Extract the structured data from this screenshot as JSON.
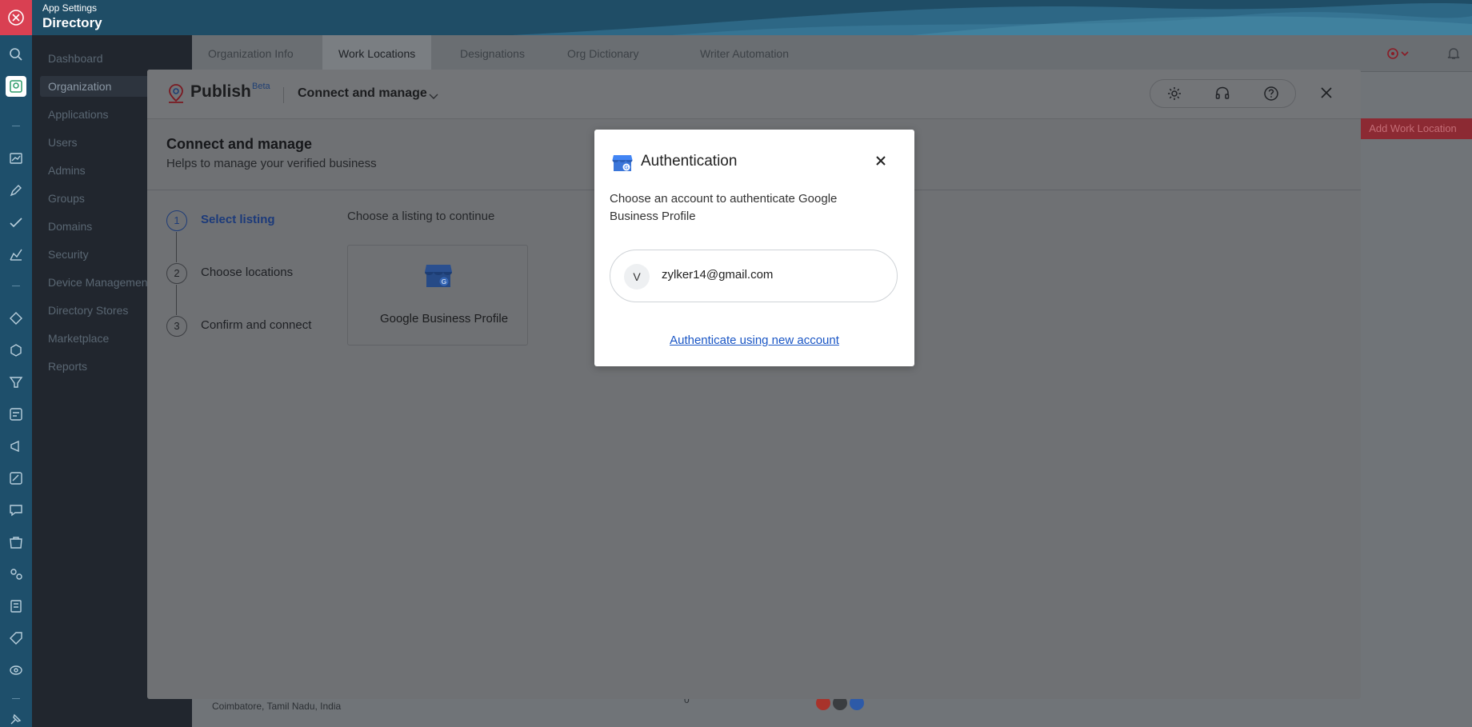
{
  "header": {
    "subtitle": "App Settings",
    "title": "Directory"
  },
  "nav": {
    "items": [
      {
        "label": "Dashboard"
      },
      {
        "label": "Organization",
        "active": true
      },
      {
        "label": "Applications"
      },
      {
        "label": "Users"
      },
      {
        "label": "Admins"
      },
      {
        "label": "Groups"
      },
      {
        "label": "Domains"
      },
      {
        "label": "Security"
      },
      {
        "label": "Device Management"
      },
      {
        "label": "Directory Stores"
      },
      {
        "label": "Marketplace"
      },
      {
        "label": "Reports"
      }
    ]
  },
  "tabs": [
    {
      "label": "Organization Info"
    },
    {
      "label": "Work Locations",
      "active": true
    },
    {
      "label": "Designations"
    },
    {
      "label": "Org Dictionary"
    },
    {
      "label": "Writer Automation"
    }
  ],
  "background": {
    "add_button": "Add Work Location",
    "row_location": "Coimbatore, Tamil Nadu, India",
    "row_count": "0",
    "row_dash": "--"
  },
  "publish": {
    "title": "Publish",
    "badge": "Beta",
    "context": "Connect and manage",
    "section_title": "Connect and manage",
    "section_subtitle": "Helps to manage your verified business",
    "steps": [
      {
        "num": "1",
        "label": "Select listing",
        "active": true
      },
      {
        "num": "2",
        "label": "Choose locations"
      },
      {
        "num": "3",
        "label": "Confirm and connect"
      }
    ],
    "choose_prompt": "Choose a listing to continue",
    "listing": {
      "label": "Google Business Profile"
    }
  },
  "auth": {
    "title": "Authentication",
    "description": "Choose an account to authenticate Google Business Profile",
    "account": {
      "initial": "V",
      "email": "zylker14@gmail.com"
    },
    "new_account_link": "Authenticate using new account"
  },
  "colors": {
    "header_bg": "#1f4d66",
    "close_accent": "#d94052",
    "link": "#1a56c5",
    "step_active": "#1c3a7a"
  }
}
